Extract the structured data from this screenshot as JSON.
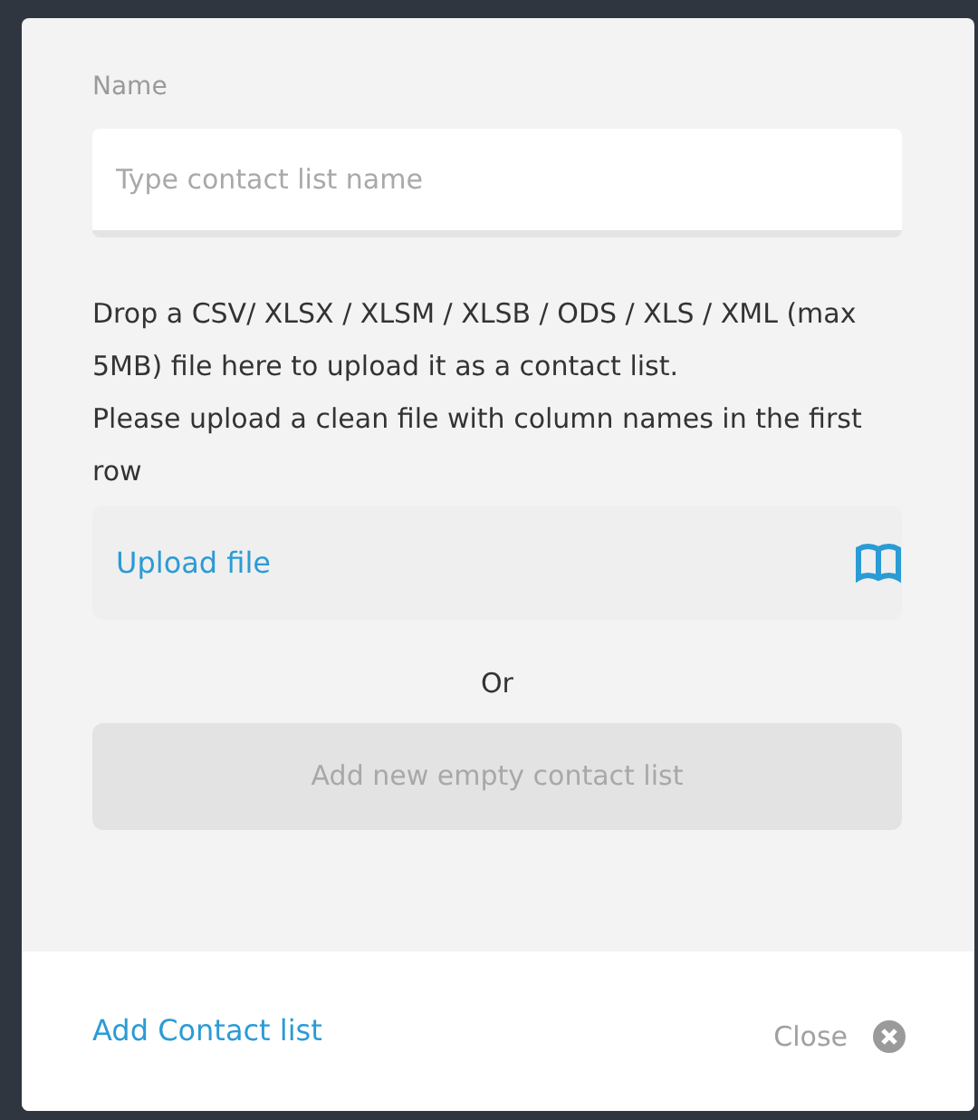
{
  "name_field": {
    "label": "Name",
    "placeholder": "Type contact list name"
  },
  "description": [
    "Drop a CSV/ XLSX / XLSM / XLSB / ODS / XLS / XML (max 5MB) file here to upload it as a contact list.",
    "Please upload a clean file with column names in the first row"
  ],
  "upload": {
    "label": "Upload file"
  },
  "separator": "Or",
  "empty_list_button": {
    "label": "Add new empty contact list",
    "disabled": true
  },
  "footer": {
    "primary": "Add Contact list",
    "close": "Close"
  }
}
